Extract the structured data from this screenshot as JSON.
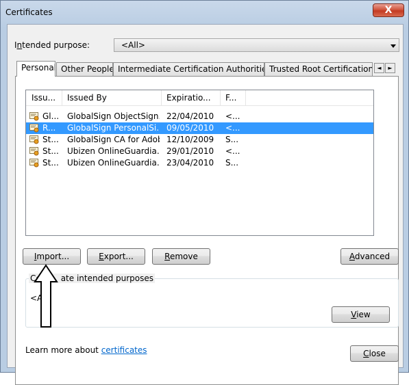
{
  "window": {
    "title": "Certificates",
    "close_glyph": "X"
  },
  "intended_purpose": {
    "label_pre": "I",
    "label_u": "n",
    "label_post": "tended purpose:",
    "value": "<All>"
  },
  "tabs": [
    {
      "label": "Personal",
      "active": true
    },
    {
      "label": "Other People",
      "active": false
    },
    {
      "label": "Intermediate Certification Authorities",
      "active": false
    },
    {
      "label": "Trusted Root Certification",
      "active": false
    }
  ],
  "tab_scroll": {
    "left": "◄",
    "right": "►"
  },
  "list": {
    "columns": [
      "Issu...",
      "Issued By",
      "Expiratio...",
      "F..."
    ],
    "rows": [
      {
        "issued_to": "Gl...",
        "issued_by": "GlobalSign ObjectSign...",
        "expiration": "22/04/2010",
        "friendly": "<...",
        "selected": false
      },
      {
        "issued_to": "R...",
        "issued_by": "GlobalSign PersonalSi...",
        "expiration": "09/05/2010",
        "friendly": "<...",
        "selected": true
      },
      {
        "issued_to": "St...",
        "issued_by": "GlobalSign CA for Adobe",
        "expiration": "12/10/2009",
        "friendly": "S...",
        "selected": false
      },
      {
        "issued_to": "St...",
        "issued_by": "Ubizen OnlineGuardia...",
        "expiration": "29/01/2010",
        "friendly": "<...",
        "selected": false
      },
      {
        "issued_to": "St...",
        "issued_by": "Ubizen OnlineGuardia...",
        "expiration": "23/04/2010",
        "friendly": "S...",
        "selected": false
      }
    ]
  },
  "buttons": {
    "import": {
      "u": "I",
      "rest": "mport..."
    },
    "export": {
      "u": "E",
      "rest": "xport..."
    },
    "remove": {
      "u": "R",
      "rest": "emove"
    },
    "advanced": {
      "u": "A",
      "rest": "dvanced"
    },
    "view": {
      "u": "V",
      "rest": "iew"
    },
    "close": {
      "u": "C",
      "rest": "lose"
    }
  },
  "purposes_group": {
    "title_a": "Cer",
    "title_b": "ate intended purposes",
    "value": "<All"
  },
  "footer": {
    "text": "Learn more about ",
    "link": "certificates"
  },
  "colors": {
    "selection": "#3399ff",
    "link": "#0066cc",
    "frame": "#b9cde3"
  }
}
